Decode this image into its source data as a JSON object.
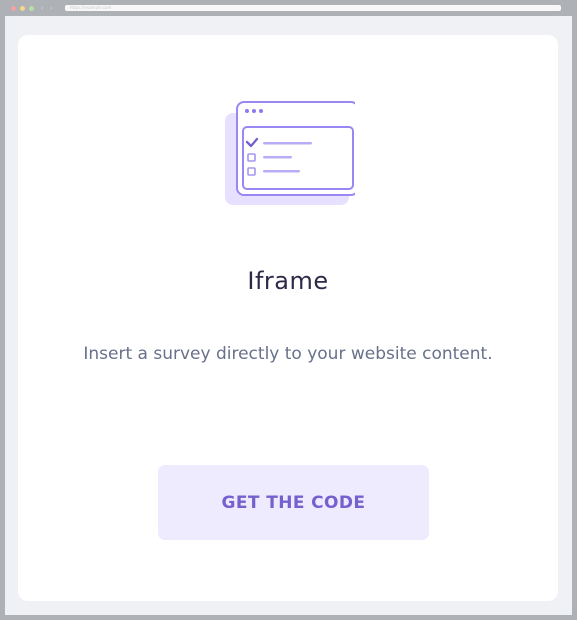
{
  "browser": {
    "address_text": "https://example.com",
    "nav_back": "‹",
    "nav_forward": "›"
  },
  "card": {
    "illustration_icon": "embedded-form-window-icon",
    "heading": "Iframe",
    "description": "Insert a survey directly to your website content.",
    "button_label": "GET THE CODE"
  },
  "colors": {
    "brand_purple": "#7660ce",
    "button_background": "#efebff",
    "heading_text": "#2d2948",
    "body_text": "#68708a"
  }
}
